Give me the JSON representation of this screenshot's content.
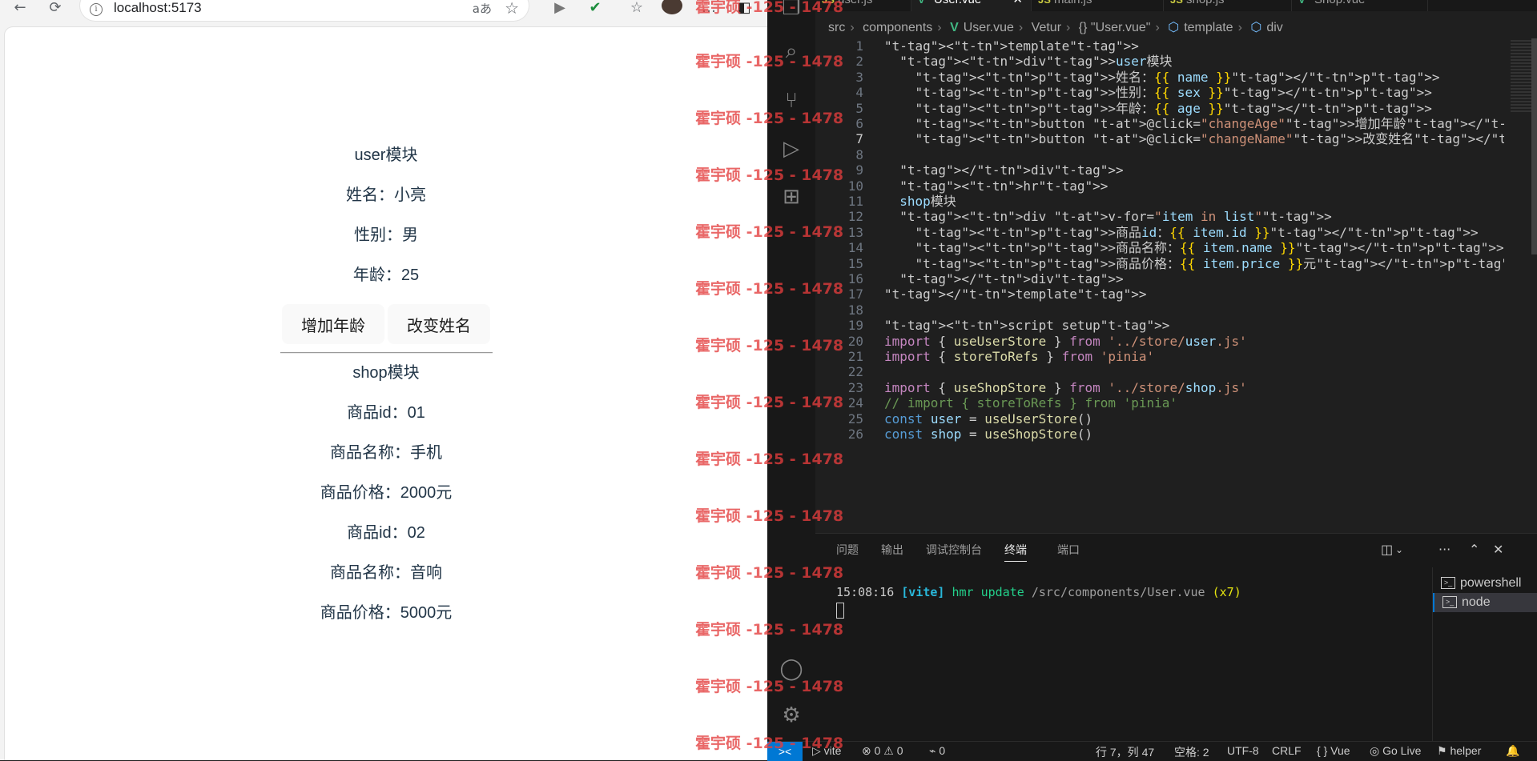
{
  "browser": {
    "url": "localhost:5173",
    "read_aloud": "aあ"
  },
  "app": {
    "user_title": "user模块",
    "name_line": "姓名：小亮",
    "sex_line": "性别：男",
    "age_line": "年龄：25",
    "btn_age": "增加年龄",
    "btn_name": "改变姓名",
    "shop_title": "shop模块",
    "items": [
      {
        "id": "商品id：01",
        "name": "商品名称：手机",
        "price": "商品价格：2000元"
      },
      {
        "id": "商品id：02",
        "name": "商品名称：音响",
        "price": "商品价格：5000元"
      }
    ]
  },
  "watermark": "霍宇硕 -125 - 1478",
  "vscode": {
    "tabs": [
      {
        "icon": "JS",
        "label": "user.js"
      },
      {
        "icon": "V",
        "label": "User.vue"
      },
      {
        "icon": "JS",
        "label": "main.js"
      },
      {
        "icon": "JS",
        "label": "shop.js"
      },
      {
        "icon": "V",
        "label": "Shop.vue"
      }
    ],
    "breadcrumb": [
      "src",
      "components",
      "User.vue",
      "Vetur",
      "{} \"User.vue\"",
      "template",
      "div"
    ],
    "code_lines": [
      "<template>",
      "  <div>user模块",
      "    <p>姓名：{{ name }}</p>",
      "    <p>性别：{{ sex }}</p>",
      "    <p>年龄：{{ age }}</p>",
      "    <button @click=\"changeAge\">增加年龄</button>",
      "    <button @click=\"changeName\">改变姓名</button>",
      "",
      "  </div>",
      "  <hr>",
      "  shop模块",
      "  <div v-for=\"item in list\">",
      "    <p>商品id：{{ item.id }}</p>",
      "    <p>商品名称：{{ item.name }}</p>",
      "    <p>商品价格：{{ item.price }}元</p>",
      "  </div>",
      "</template>",
      "",
      "<script setup>",
      "import { useUserStore } from '../store/user.js'",
      "import { storeToRefs } from 'pinia'",
      "",
      "import { useShopStore } from '../store/shop.js'",
      "// import { storeToRefs } from 'pinia'",
      "const user = useUserStore()",
      "const shop = useShopStore()"
    ],
    "panel_tabs": [
      "问题",
      "输出",
      "调试控制台",
      "终端",
      "端口"
    ],
    "terminal": {
      "time": "15:08:16",
      "tag": "[vite]",
      "msg": "hmr update",
      "path": "/src/components/User.vue",
      "count": "(x7)"
    },
    "terminals": [
      "powershell",
      "node"
    ],
    "status": {
      "remote": "><",
      "vite": "vite",
      "problems": "⊗ 0 ⚠ 0",
      "ports": "⌁ 0",
      "position": "行 7，列 47",
      "spaces": "空格: 2",
      "encoding": "UTF-8",
      "eol": "CRLF",
      "lang": "Vue",
      "golive": "Go Live",
      "helper": "helper"
    }
  },
  "colors": {
    "accent": "#0078d4",
    "watermark": "#e43d3d",
    "vue_green": "#41b883",
    "js_yellow": "#cbcb41"
  }
}
